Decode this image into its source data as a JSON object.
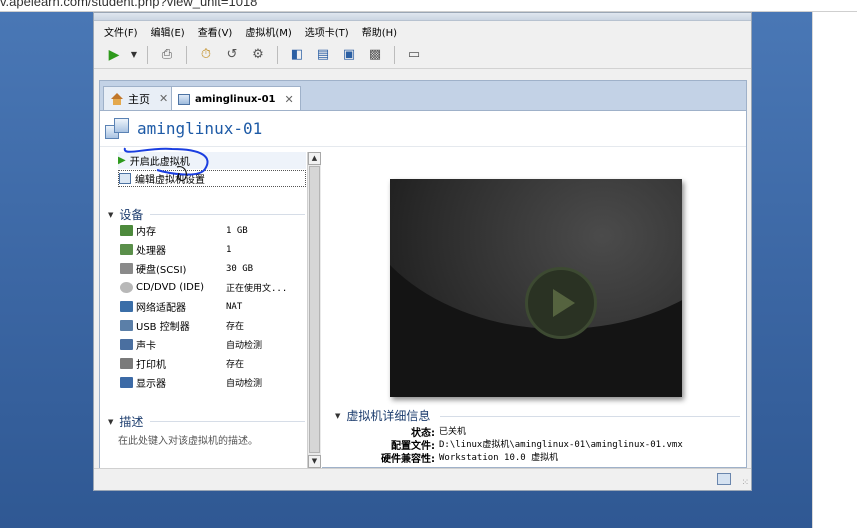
{
  "browser": {
    "url_fragment": "v.apelearn.com/student.php?view_unit=1018"
  },
  "menu": [
    "文件(F)",
    "编辑(E)",
    "查看(V)",
    "虚拟机(M)",
    "选项卡(T)",
    "帮助(H)"
  ],
  "toolbar": {
    "icons": [
      "play-icon",
      "dropdown-icon",
      "snapshot-icon",
      "snapshot-take-icon",
      "snapshot-revert-icon",
      "snapshot-manager-icon",
      "view-console-icon",
      "view-fullscreen-icon",
      "view-unity-icon",
      "view-stretch-icon",
      "view-thumbnail-icon"
    ]
  },
  "tabs": {
    "home": "主页",
    "vm": "aminglinux-01"
  },
  "vm": {
    "title": "aminglinux-01",
    "power_on": "开启此虚拟机",
    "edit_settings": "编辑虚拟机设置"
  },
  "devices": {
    "header": "设备",
    "items": [
      {
        "name": "内存",
        "value": "1 GB",
        "icon": "memory-icon",
        "color": "#4d8a3c"
      },
      {
        "name": "处理器",
        "value": "1",
        "icon": "cpu-icon",
        "color": "#5a8f4a"
      },
      {
        "name": "硬盘(SCSI)",
        "value": "30 GB",
        "icon": "harddisk-icon",
        "color": "#8a8a8a"
      },
      {
        "name": "CD/DVD (IDE)",
        "value": "正在使用文...",
        "icon": "cdrom-icon",
        "color": "#b8b8b8"
      },
      {
        "name": "网络适配器",
        "value": "NAT",
        "icon": "network-icon",
        "color": "#3a6ea8"
      },
      {
        "name": "USB 控制器",
        "value": "存在",
        "icon": "usb-icon",
        "color": "#5b7fa8"
      },
      {
        "name": "声卡",
        "value": "自动检测",
        "icon": "sound-icon",
        "color": "#4a6fa0"
      },
      {
        "name": "打印机",
        "value": "存在",
        "icon": "printer-icon",
        "color": "#7a7a7a"
      },
      {
        "name": "显示器",
        "value": "自动检测",
        "icon": "monitor-icon",
        "color": "#3c6aa6"
      }
    ]
  },
  "description": {
    "header": "描述",
    "placeholder": "在此处键入对该虚拟机的描述。"
  },
  "details": {
    "header": "虚拟机详细信息",
    "rows": [
      {
        "key": "状态:",
        "value": "已关机"
      },
      {
        "key": "配置文件:",
        "value": "D:\\linux虚拟机\\aminglinux-01\\aminglinux-01.vmx"
      },
      {
        "key": "硬件兼容性:",
        "value": "Workstation 10.0 虚拟机"
      }
    ]
  },
  "colors": {
    "accent": "#1d5aa6",
    "desktop": "#3f6ba8",
    "play_green": "#2e9a1c"
  }
}
